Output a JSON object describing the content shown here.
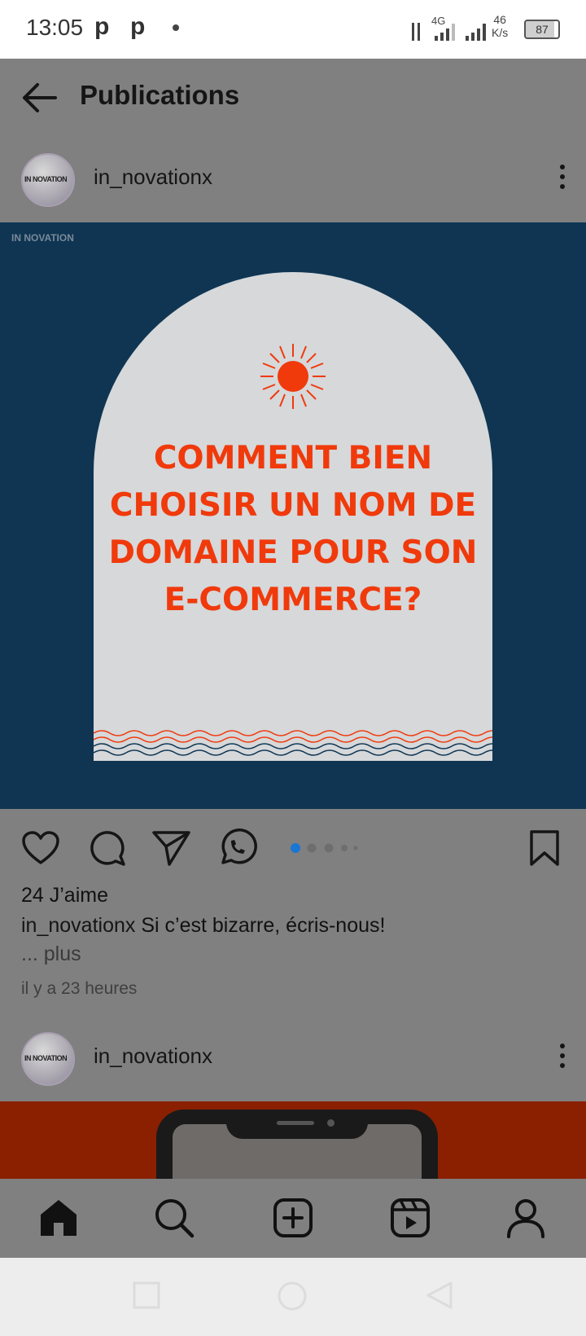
{
  "status": {
    "time": "13:05",
    "notif_icons": [
      "p",
      "p"
    ],
    "network": "4G",
    "speed_value": "46",
    "speed_unit": "K/s",
    "battery": "87"
  },
  "header": {
    "title": "Publications"
  },
  "post1": {
    "username": "in_novationx",
    "avatar_text": "IN NOVATION",
    "brand_mark": "IN NOVATION",
    "headline_lines": [
      "COMMENT BIEN",
      "CHOISIR UN NOM DE",
      "DOMAINE POUR SON",
      "E-COMMERCE?"
    ],
    "likes": "24 J’aime",
    "caption_user": "in_novationx",
    "caption_text": "Si c’est bizarre, écris-nous!",
    "more_label": "... plus",
    "time_ago": "il y a 23 heures",
    "carousel": {
      "count": 5,
      "active": 1
    }
  },
  "post2": {
    "username": "in_novationx",
    "avatar_text": "IN NOVATION"
  },
  "colors": {
    "post_bg": "#0f3552",
    "headline": "#f03a0c",
    "accent": "#1976d2",
    "dim_overlay": "#808080"
  },
  "icons": {
    "header": "back-arrow-icon",
    "actions": [
      "heart-icon",
      "comment-icon",
      "send-icon",
      "whatsapp-icon",
      "bookmark-icon"
    ],
    "nav": [
      "home-icon",
      "search-icon",
      "add-post-icon",
      "reels-icon",
      "profile-icon"
    ],
    "system": [
      "recent-apps-icon",
      "home-circle-icon",
      "back-triangle-icon"
    ]
  }
}
